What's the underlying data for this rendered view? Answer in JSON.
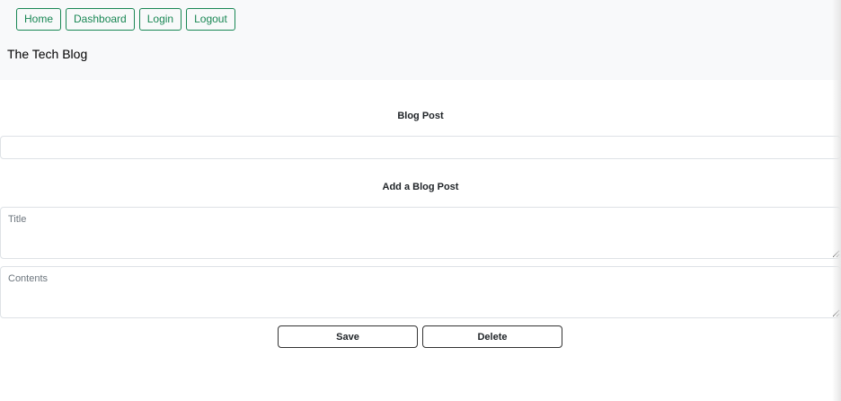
{
  "nav": {
    "items": [
      {
        "label": "Home"
      },
      {
        "label": "Dashboard"
      },
      {
        "label": "Login"
      },
      {
        "label": "Logout"
      }
    ]
  },
  "brand": {
    "title": "The Tech Blog"
  },
  "blog_post": {
    "heading": "Blog Post"
  },
  "add_post": {
    "heading": "Add a Blog Post",
    "title_placeholder": "Title",
    "contents_placeholder": "Contents"
  },
  "actions": {
    "save_label": "Save",
    "delete_label": "Delete"
  },
  "colors": {
    "accent": "#198754",
    "header_bg": "#f8f9fa",
    "border": "#dee2e6"
  }
}
